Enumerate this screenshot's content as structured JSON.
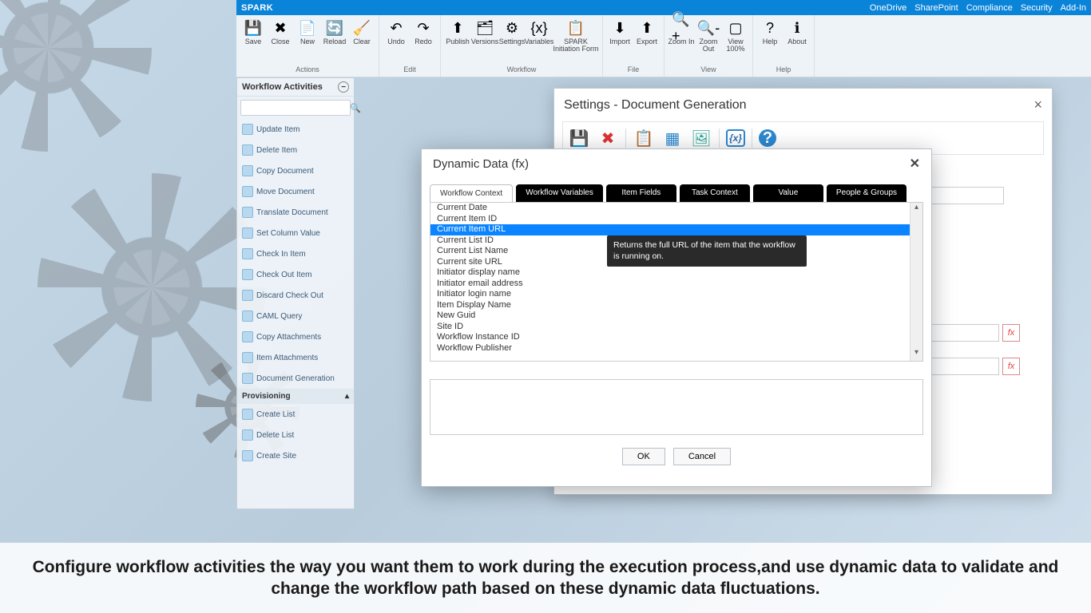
{
  "topbar": {
    "brand": "SPARK",
    "links": [
      "OneDrive",
      "SharePoint",
      "Compliance",
      "Security",
      "Add-In"
    ]
  },
  "ribbon": {
    "groups": [
      {
        "label": "Actions",
        "buttons": [
          {
            "label": "Save",
            "icon": "💾"
          },
          {
            "label": "Close",
            "icon": "✖"
          },
          {
            "label": "New",
            "icon": "📄"
          },
          {
            "label": "Reload",
            "icon": "🔄"
          },
          {
            "label": "Clear",
            "icon": "🧹"
          }
        ]
      },
      {
        "label": "Edit",
        "buttons": [
          {
            "label": "Undo",
            "icon": "↶"
          },
          {
            "label": "Redo",
            "icon": "↷"
          }
        ]
      },
      {
        "label": "Workflow",
        "buttons": [
          {
            "label": "Publish",
            "icon": "⬆"
          },
          {
            "label": "Versions",
            "icon": "🗂"
          },
          {
            "label": "Settings",
            "icon": "⚙"
          },
          {
            "label": "Variables",
            "icon": "{x}"
          },
          {
            "label": "SPARK Initiation Form",
            "icon": "📋",
            "wide": true
          }
        ]
      },
      {
        "label": "File",
        "buttons": [
          {
            "label": "Import",
            "icon": "⬇"
          },
          {
            "label": "Export",
            "icon": "⬆"
          }
        ]
      },
      {
        "label": "View",
        "buttons": [
          {
            "label": "Zoom In",
            "icon": "🔍+"
          },
          {
            "label": "Zoom Out",
            "icon": "🔍-"
          },
          {
            "label": "View 100%",
            "icon": "▢"
          }
        ]
      },
      {
        "label": "Help",
        "buttons": [
          {
            "label": "Help",
            "icon": "?"
          },
          {
            "label": "About",
            "icon": "ℹ"
          }
        ]
      }
    ]
  },
  "wa": {
    "title": "Workflow Activities",
    "items": [
      "Update Item",
      "Delete Item",
      "Copy Document",
      "Move Document",
      "Translate Document",
      "Set Column Value",
      "Check In Item",
      "Check Out Item",
      "Discard Check Out",
      "CAML Query",
      "Copy Attachments",
      "Item Attachments",
      "Document Generation"
    ],
    "section": "Provisioning",
    "sectionItems": [
      "Create List",
      "Delete List",
      "Create Site"
    ]
  },
  "settings": {
    "title": "Settings - Document Generation",
    "toolbar_icons": [
      "save",
      "close",
      "clipboard",
      "table",
      "image",
      "fx",
      "help"
    ]
  },
  "dd": {
    "title": "Dynamic Data (fx)",
    "tabs": [
      "Workflow Context",
      "Workflow Variables",
      "Item Fields",
      "Task Context",
      "Value",
      "People & Groups"
    ],
    "activeTab": 0,
    "items": [
      "Current Date",
      "Current Item ID",
      "Current Item URL",
      "Current List ID",
      "Current List Name",
      "Current site URL",
      "Initiator display name",
      "Initiator email address",
      "Initiator login name",
      "Item Display Name",
      "New Guid",
      "Site ID",
      "Workflow Instance ID",
      "Workflow Publisher"
    ],
    "selectedIndex": 2,
    "tooltip": "Returns the full URL of the item that the workflow is running on.",
    "ok": "OK",
    "cancel": "Cancel"
  },
  "caption": "Configure workflow activities the way you want them to work during the execution process,and use dynamic data to validate and change the workflow path based on these dynamic data fluctuations."
}
